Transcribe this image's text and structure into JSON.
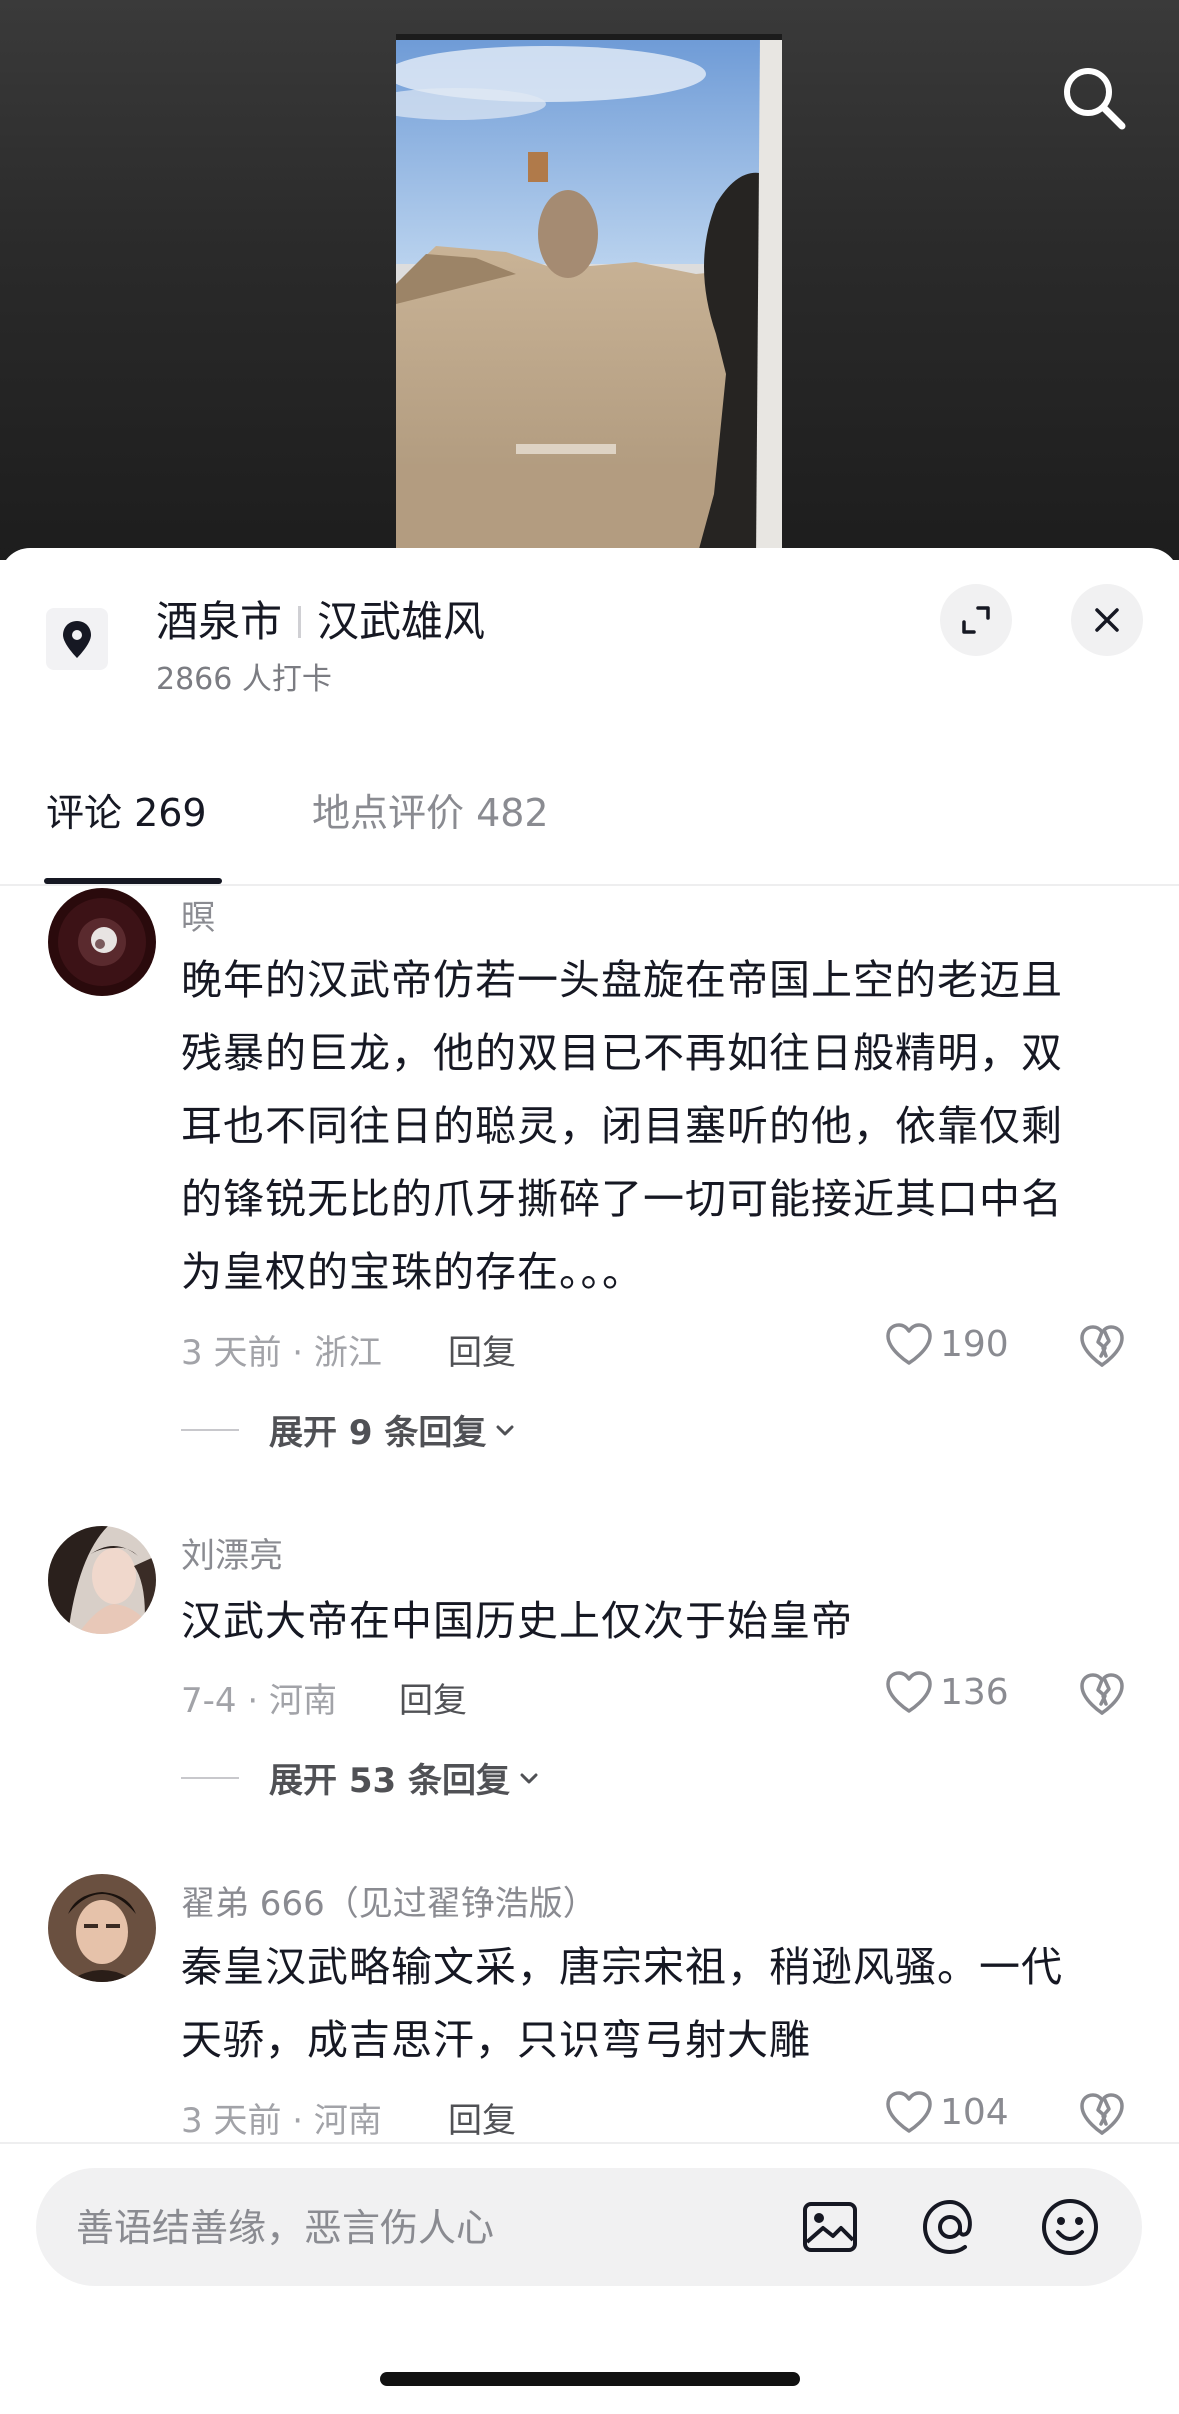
{
  "location": {
    "city": "酒泉市",
    "spot": "汉武雄风",
    "checkins": "2866 人打卡"
  },
  "tabs": [
    {
      "label": "评论 269"
    },
    {
      "label": "地点评价 482"
    }
  ],
  "comments": [
    {
      "user": "暝",
      "text": "晚年的汉武帝仿若一头盘旋在帝国上空的老迈且残暴的巨龙，他的双目已不再如往日般精明，双耳也不同往日的聪灵，闭目塞听的他，依靠仅剩的锋锐无比的爪牙撕碎了一切可能接近其口中名为皇权的宝珠的存在。。。",
      "meta": "3 天前 · 浙江",
      "reply": "回复",
      "likes": "190",
      "expand": "展开 9 条回复"
    },
    {
      "user": "刘漂亮",
      "text": "汉武大帝在中国历史上仅次于始皇帝",
      "meta": "7-4 · 河南",
      "reply": "回复",
      "likes": "136",
      "expand": "展开 53 条回复"
    },
    {
      "user": "翟弟 666（见过翟铮浩版）",
      "text": "秦皇汉武略输文采，唐宗宋祖，稍逊风骚。一代天骄，成吉思汗，只识弯弓射大雕",
      "meta": "3 天前 · 河南",
      "reply": "回复",
      "likes": "104"
    }
  ],
  "input": {
    "placeholder": "善语结善缘，恶言伤人心"
  },
  "icons": {
    "search": "search-icon",
    "location": "location-pin-icon",
    "expand": "expand-icon",
    "close": "close-icon",
    "like": "heart-icon",
    "dislike": "broken-heart-icon",
    "image": "image-icon",
    "mention": "at-icon",
    "emoji": "emoji-icon"
  }
}
